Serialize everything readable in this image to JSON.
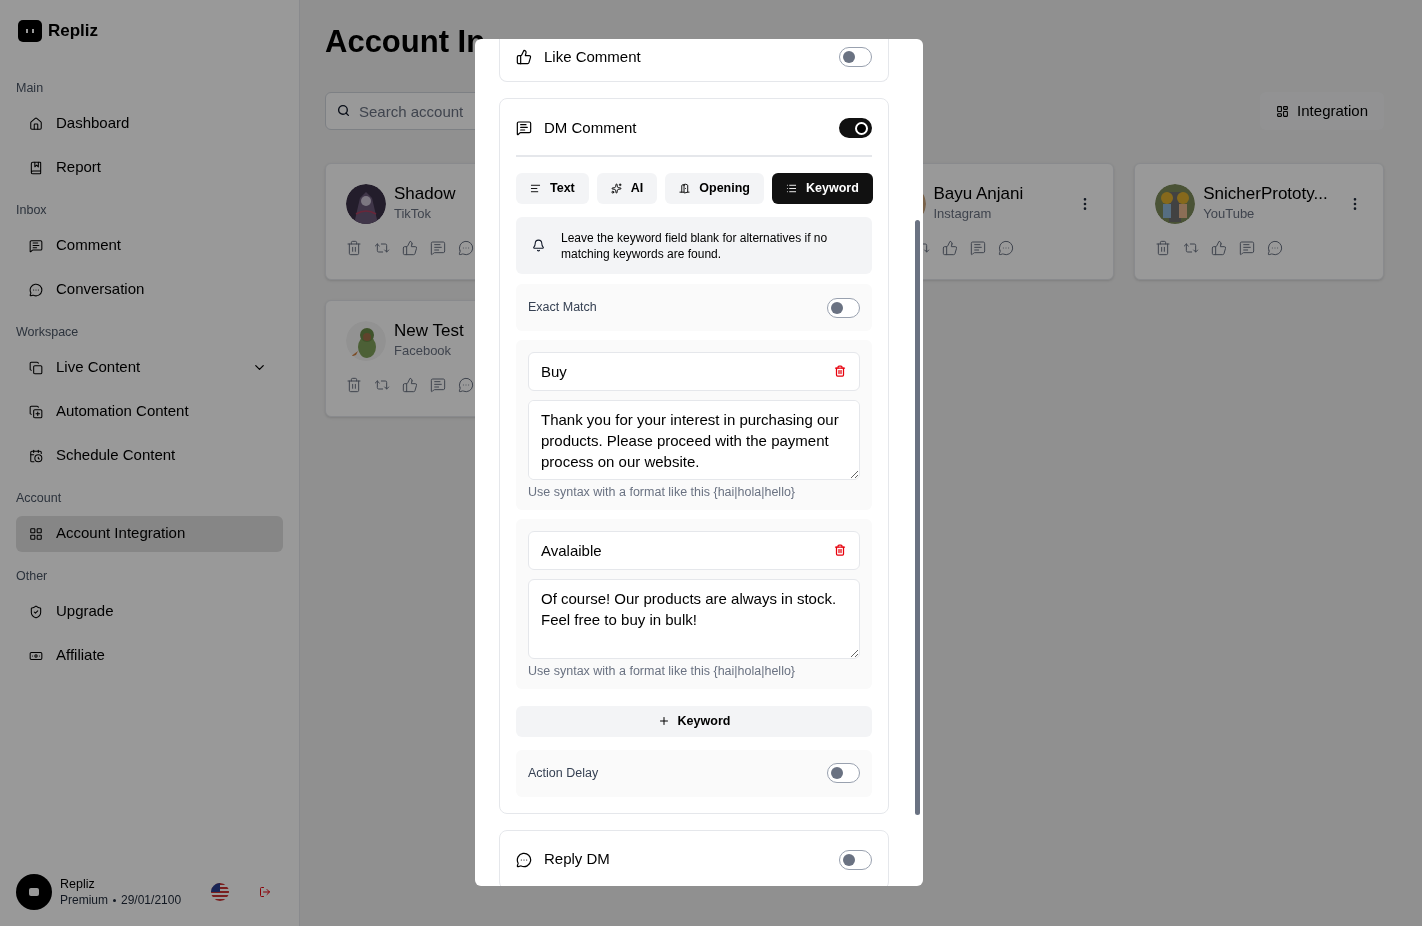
{
  "sidebar": {
    "brand": "Repliz",
    "sections": [
      {
        "title": "Main",
        "items": [
          {
            "label": "Dashboard",
            "kind": "link",
            "selected": false
          },
          {
            "label": "Report",
            "kind": "link",
            "selected": false
          }
        ]
      },
      {
        "title": "Inbox",
        "items": [
          {
            "label": "Comment",
            "kind": "link",
            "selected": false
          },
          {
            "label": "Conversation",
            "kind": "link",
            "selected": false
          }
        ]
      },
      {
        "title": "Workspace",
        "items": [
          {
            "label": "Live Content",
            "kind": "dropdown",
            "selected": false
          },
          {
            "label": "Automation Content",
            "kind": "link",
            "selected": false
          },
          {
            "label": "Schedule Content",
            "kind": "link",
            "selected": false
          }
        ]
      },
      {
        "title": "Account",
        "items": [
          {
            "label": "Account Integration",
            "kind": "link",
            "selected": true
          }
        ]
      },
      {
        "title": "Other",
        "items": [
          {
            "label": "Upgrade",
            "kind": "link",
            "selected": false
          },
          {
            "label": "Affiliate",
            "kind": "link",
            "selected": false
          }
        ]
      }
    ],
    "user": {
      "name": "Repliz",
      "plan": "Premium",
      "expiry": "29/01/2100"
    }
  },
  "main": {
    "title": "Account In",
    "search": {
      "placeholder": "Search account"
    },
    "integration_button": "Integration",
    "accounts": [
      {
        "name": "Shadow",
        "platform": "TikTok"
      },
      {
        "name": "Bayu Anjani",
        "platform": "Instagram"
      },
      {
        "name": "SnicherPrototy...",
        "platform": "YouTube"
      },
      {
        "name": "New Test",
        "platform": "Facebook"
      }
    ]
  },
  "modal": {
    "features": [
      {
        "title": "Like Comment",
        "on": false
      },
      {
        "title": "DM Comment",
        "on": true
      },
      {
        "title": "Reply DM",
        "on": false
      }
    ],
    "dm_comment": {
      "tabs": [
        {
          "label": "Text",
          "selected": false
        },
        {
          "label": "AI",
          "selected": false
        },
        {
          "label": "Opening",
          "selected": false
        },
        {
          "label": "Keyword",
          "selected": true
        }
      ],
      "note": "Leave the keyword field blank for alternatives if no matching keywords are found.",
      "exact_match": {
        "label": "Exact Match",
        "on": false
      },
      "keywords": [
        {
          "keyword": "Buy",
          "reply": "Thank you for your interest in purchasing our products. Please proceed with the payment process on our website.",
          "hint": "Use syntax with a format like this {hai|hola|hello}"
        },
        {
          "keyword": "Avalaible",
          "reply": "Of course! Our products are always in stock. Feel free to buy in bulk!",
          "hint": "Use syntax with a format like this {hai|hola|hello}"
        }
      ],
      "add_button": "Keyword",
      "action_delay": {
        "label": "Action Delay",
        "on": false
      }
    }
  }
}
